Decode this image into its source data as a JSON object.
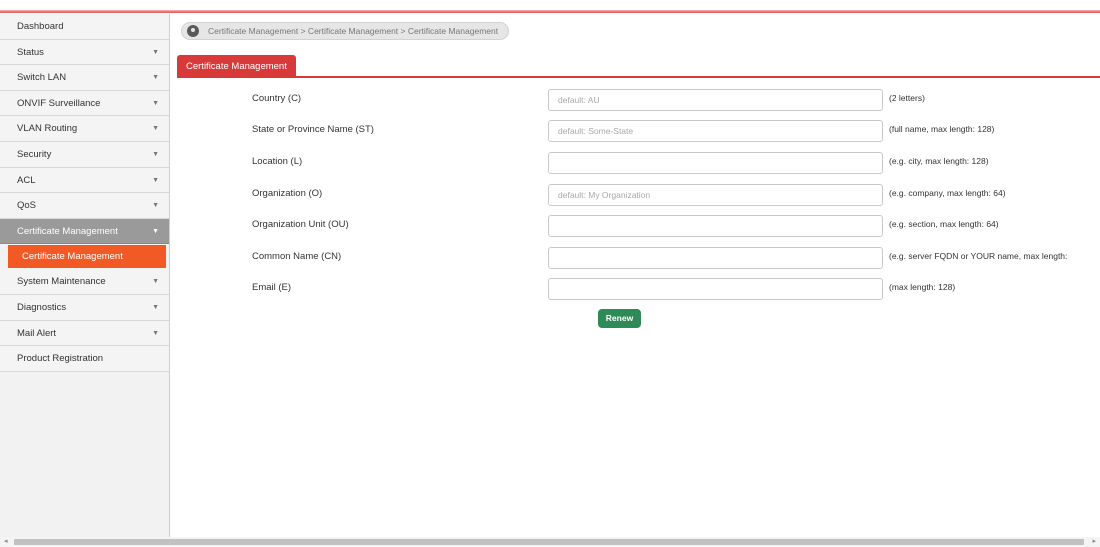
{
  "sidebar": {
    "items": [
      {
        "label": "Dashboard",
        "has_chevron": false
      },
      {
        "label": "Status",
        "has_chevron": true
      },
      {
        "label": "Switch LAN",
        "has_chevron": true
      },
      {
        "label": "ONVIF Surveillance",
        "has_chevron": true
      },
      {
        "label": "VLAN Routing",
        "has_chevron": true
      },
      {
        "label": "Security",
        "has_chevron": true
      },
      {
        "label": "ACL",
        "has_chevron": true
      },
      {
        "label": "QoS",
        "has_chevron": true
      },
      {
        "label": "Certificate Management",
        "has_chevron": true,
        "active": true
      },
      {
        "label": "System Maintenance",
        "has_chevron": true
      },
      {
        "label": "Diagnostics",
        "has_chevron": true
      },
      {
        "label": "Mail Alert",
        "has_chevron": true
      },
      {
        "label": "Product Registration",
        "has_chevron": false
      }
    ],
    "active_sub_item": "Certificate Management",
    "chevron_icon": "chevron-down-icon"
  },
  "breadcrumb": {
    "icon": "location-pin-icon",
    "text": "Certificate Management > Certificate Management > Certificate Management"
  },
  "tab": {
    "label": "Certificate Management"
  },
  "form": {
    "rows": [
      {
        "label": "Country (C)",
        "value": "",
        "placeholder": "default: AU",
        "hint": "(2 letters)"
      },
      {
        "label": "State or Province Name (ST)",
        "value": "",
        "placeholder": "default: Some-State",
        "hint": "(full name, max length: 128)"
      },
      {
        "label": "Location (L)",
        "value": "",
        "placeholder": "",
        "hint": "(e.g. city, max length: 128)"
      },
      {
        "label": "Organization (O)",
        "value": "",
        "placeholder": "default: My Organization",
        "hint": "(e.g. company, max length: 64)"
      },
      {
        "label": "Organization Unit (OU)",
        "value": "",
        "placeholder": "",
        "hint": "(e.g. section, max length: 64)"
      },
      {
        "label": "Common Name (CN)",
        "value": "",
        "placeholder": "",
        "hint": "(e.g. server FQDN or YOUR name, max length:"
      },
      {
        "label": "Email (E)",
        "value": "",
        "placeholder": "",
        "hint": "(max length: 128)"
      }
    ],
    "renew_label": "Renew"
  },
  "colors": {
    "accent_red": "#d83a3a",
    "active_sub_orange": "#f15a24",
    "renew_green": "#2e8b57",
    "sidebar_active_gray": "#9a9a9a"
  }
}
